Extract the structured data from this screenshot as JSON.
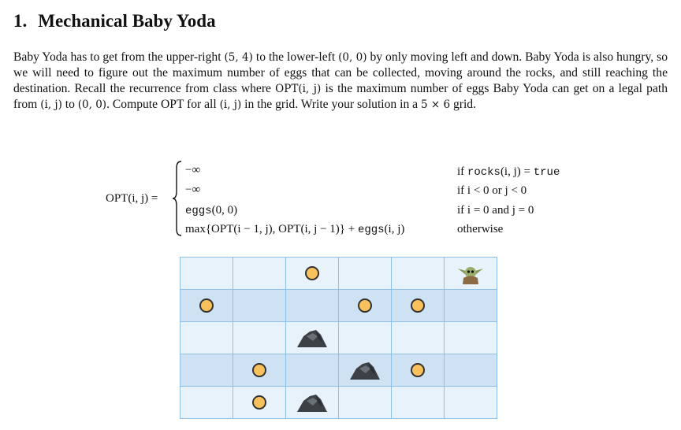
{
  "section": {
    "number": "1.",
    "title": "Mechanical Baby Yoda"
  },
  "paragraph": {
    "s1": "Baby Yoda has to get from the upper-right ",
    "p1": "(5, 4)",
    "s2": " to the lower-left ",
    "p2": "(0, 0)",
    "s3": " by only moving left and down. Baby Yoda is also hungry, so we will need to figure out the maximum number of eggs that can be collected, moving around the rocks, and still reaching the destination. Recall the recurrence from class where ",
    "opt1": "OPT(i, j)",
    "s4": " is the maximum number of eggs Baby Yoda can get on a legal path from ",
    "p3": "(i, j)",
    "s5": " to ",
    "p4": "(0, 0)",
    "s6": ". Compute OPT for all ",
    "p5": "(i, j)",
    "s7": " in the grid. Write your solution in a ",
    "dims": "5 × 6",
    "s8": " grid."
  },
  "recurrence": {
    "lhs": "OPT(i, j) =",
    "cases": [
      {
        "expr": "−∞",
        "cond_pre": "if ",
        "cond_fn": "rocks",
        "cond_mid": "(i, j) = ",
        "cond_tt": "true"
      },
      {
        "expr": "−∞",
        "cond_pre": "if i < 0 or j < 0",
        "cond_fn": "",
        "cond_mid": "",
        "cond_tt": ""
      },
      {
        "expr_fn": "eggs",
        "expr": "(0, 0)",
        "cond_pre": "if i = 0 and j = 0",
        "cond_fn": "",
        "cond_mid": "",
        "cond_tt": ""
      },
      {
        "expr": "max{OPT(i − 1, j), OPT(i, j − 1)} + ",
        "expr_fn": "eggs",
        "expr_tail": "(i, j)",
        "cond_pre": "otherwise",
        "cond_fn": "",
        "cond_mid": "",
        "cond_tt": ""
      }
    ]
  },
  "grid": {
    "rows": 5,
    "cols": 6,
    "cells": [
      [
        "",
        "",
        "egg",
        "",
        "",
        "yoda"
      ],
      [
        "egg",
        "",
        "",
        "egg",
        "egg",
        ""
      ],
      [
        "",
        "",
        "rock",
        "",
        "",
        ""
      ],
      [
        "",
        "egg",
        "",
        "rock",
        "egg",
        ""
      ],
      [
        "",
        "egg",
        "rock",
        "",
        "",
        ""
      ]
    ],
    "colors": {
      "light": "#e8f2fb",
      "dark": "#cfe2f3",
      "border": "#8fc0e6",
      "egg": "#f8c15c"
    }
  }
}
